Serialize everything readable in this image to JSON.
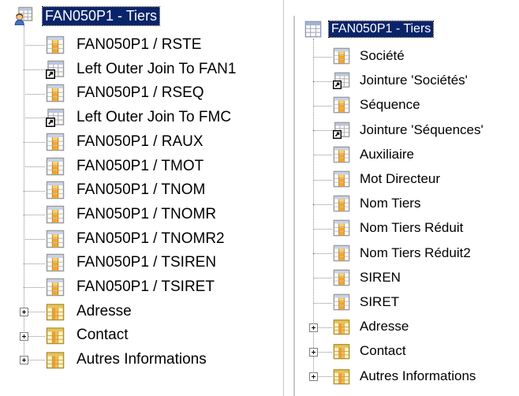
{
  "left_tree": {
    "root": {
      "label": "FAN050P1 - Tiers",
      "icon": "table-user-icon",
      "selected": true
    },
    "children": [
      {
        "label": "FAN050P1 / RSTE",
        "icon": "table-column-icon"
      },
      {
        "label": "Left Outer Join To FAN1",
        "icon": "join-icon"
      },
      {
        "label": "FAN050P1 / RSEQ",
        "icon": "table-column-icon"
      },
      {
        "label": "Left Outer Join To FMC",
        "icon": "join-icon"
      },
      {
        "label": "FAN050P1 / RAUX",
        "icon": "table-column-icon"
      },
      {
        "label": "FAN050P1 / TMOT",
        "icon": "table-column-icon"
      },
      {
        "label": "FAN050P1 / TNOM",
        "icon": "table-column-icon"
      },
      {
        "label": "FAN050P1 / TNOMR",
        "icon": "table-column-icon"
      },
      {
        "label": "FAN050P1 / TNOMR2",
        "icon": "table-column-icon"
      },
      {
        "label": "FAN050P1 / TSIREN",
        "icon": "table-column-icon"
      },
      {
        "label": "FAN050P1 / TSIRET",
        "icon": "table-column-icon"
      },
      {
        "label": "Adresse",
        "icon": "folder-table-icon",
        "expandable": true
      },
      {
        "label": "Contact",
        "icon": "folder-table-icon",
        "expandable": true
      },
      {
        "label": "Autres Informations",
        "icon": "folder-table-icon",
        "expandable": true
      }
    ]
  },
  "right_tree": {
    "root": {
      "label": "FAN050P1 - Tiers",
      "icon": "table-grid-icon",
      "selected": true
    },
    "children": [
      {
        "label": "Société",
        "icon": "table-column-icon"
      },
      {
        "label": "Jointure 'Sociétés'",
        "icon": "join-icon"
      },
      {
        "label": "Séquence",
        "icon": "table-column-icon"
      },
      {
        "label": "Jointure 'Séquences'",
        "icon": "join-icon"
      },
      {
        "label": "Auxiliaire",
        "icon": "table-column-icon"
      },
      {
        "label": "Mot Directeur",
        "icon": "table-column-icon"
      },
      {
        "label": "Nom Tiers",
        "icon": "table-column-icon"
      },
      {
        "label": "Nom Tiers Réduit",
        "icon": "table-column-icon"
      },
      {
        "label": "Nom Tiers Réduit2",
        "icon": "table-column-icon"
      },
      {
        "label": "SIREN",
        "icon": "table-column-icon"
      },
      {
        "label": "SIRET",
        "icon": "table-column-icon"
      },
      {
        "label": "Adresse",
        "icon": "folder-table-icon",
        "expandable": true
      },
      {
        "label": "Contact",
        "icon": "folder-table-icon",
        "expandable": true
      },
      {
        "label": "Autres Informations",
        "icon": "folder-table-icon",
        "expandable": true
      }
    ]
  },
  "colors": {
    "selection_bg": "#0a246a",
    "selection_text": "#ffffff",
    "column_icon_orange": "#f5a623",
    "grid_icon_gray": "#9aa4b8",
    "tree_line": "#8a8a8a"
  }
}
